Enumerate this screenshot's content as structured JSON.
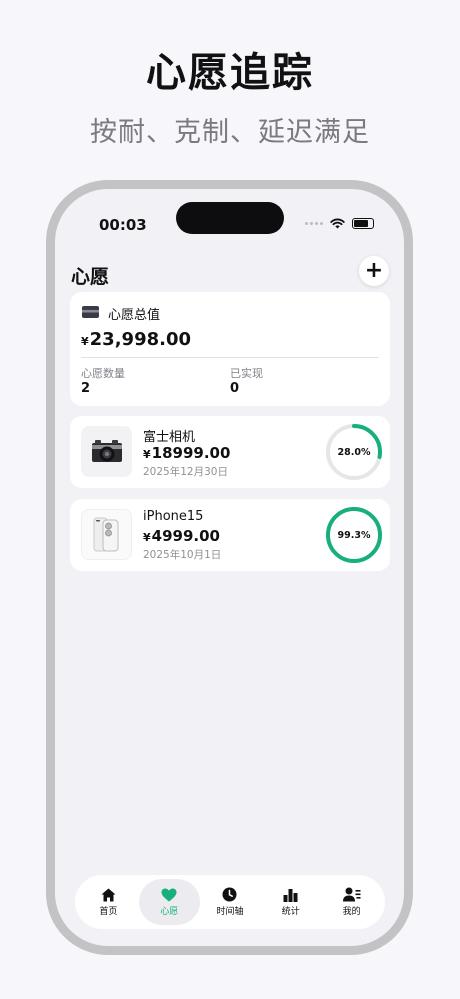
{
  "promo": {
    "title": "心愿追踪",
    "subtitle": "按耐、克制、延迟满足"
  },
  "status_bar": {
    "time": "00:03"
  },
  "nav": {
    "title": "心愿",
    "add_label": "+"
  },
  "summary": {
    "label": "心愿总值",
    "currency": "¥",
    "total": "23,998.00",
    "count_label": "心愿数量",
    "count_value": "2",
    "achieved_label": "已实现",
    "achieved_value": "0"
  },
  "wishes": [
    {
      "name": "富士相机",
      "currency": "¥",
      "price": "18999.00",
      "date": "2025年12月30日",
      "progress_text": "28.0%",
      "progress": 0.28,
      "icon": "camera-icon"
    },
    {
      "name": "iPhone15",
      "currency": "¥",
      "price": "4999.00",
      "date": "2025年10月1日",
      "progress_text": "99.3%",
      "progress": 0.993,
      "icon": "phone-icon"
    }
  ],
  "tabs": [
    {
      "label": "首页",
      "icon": "home-icon",
      "active": false
    },
    {
      "label": "心愿",
      "icon": "heart-icon",
      "active": true
    },
    {
      "label": "时间轴",
      "icon": "clock-icon",
      "active": false
    },
    {
      "label": "统计",
      "icon": "bar-chart-icon",
      "active": false
    },
    {
      "label": "我的",
      "icon": "profile-icon",
      "active": false
    }
  ],
  "colors": {
    "accent": "#17b07c",
    "ring_track": "#e6e6e9",
    "background": "#f2f1f6"
  }
}
